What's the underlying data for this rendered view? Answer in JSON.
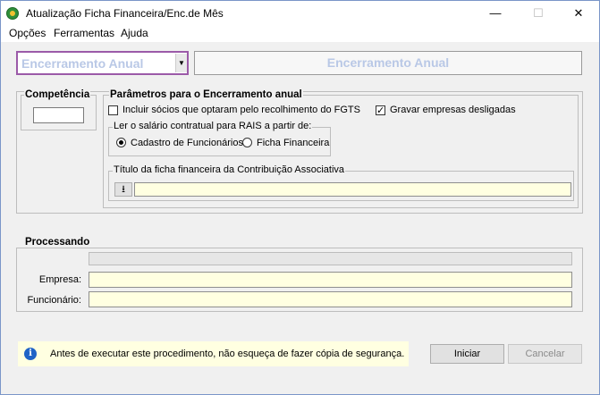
{
  "window": {
    "title": "Atualização Ficha Financeira/Enc.de Mês",
    "minimize": "—",
    "maximize": "☐",
    "close": "✕"
  },
  "menu": [
    "Opções",
    "Ferramentas",
    "Ajuda"
  ],
  "mode": {
    "selected": "Encerramento Anual",
    "title": "Encerramento Anual"
  },
  "competencia": {
    "label": "Competência",
    "value": ""
  },
  "parametros": {
    "label": "Parâmetros para o Encerramento anual",
    "incluir_socios": {
      "label": "Incluir sócios que optaram pelo recolhimento do FGTS",
      "checked": false
    },
    "gravar_desligadas": {
      "label": "Gravar empresas desligadas",
      "checked": true
    },
    "rais": {
      "label": "Ler o salário contratual para RAIS a partir de:",
      "option1": "Cadastro de Funcionários",
      "option2": "Ficha Financeira",
      "selected": "Cadastro de Funcionários"
    },
    "titulo_ficha": {
      "label": "Título da ficha financeira da Contribuição Associativa",
      "value": ""
    }
  },
  "processando": {
    "label": "Processando",
    "empresa_label": "Empresa:",
    "funcionario_label": "Funcionário:",
    "empresa": "",
    "funcionario": ""
  },
  "info": "Antes de executar este procedimento, não esqueça de fazer cópia de segurança.",
  "buttons": {
    "iniciar": "Iniciar",
    "cancelar": "Cancelar"
  }
}
